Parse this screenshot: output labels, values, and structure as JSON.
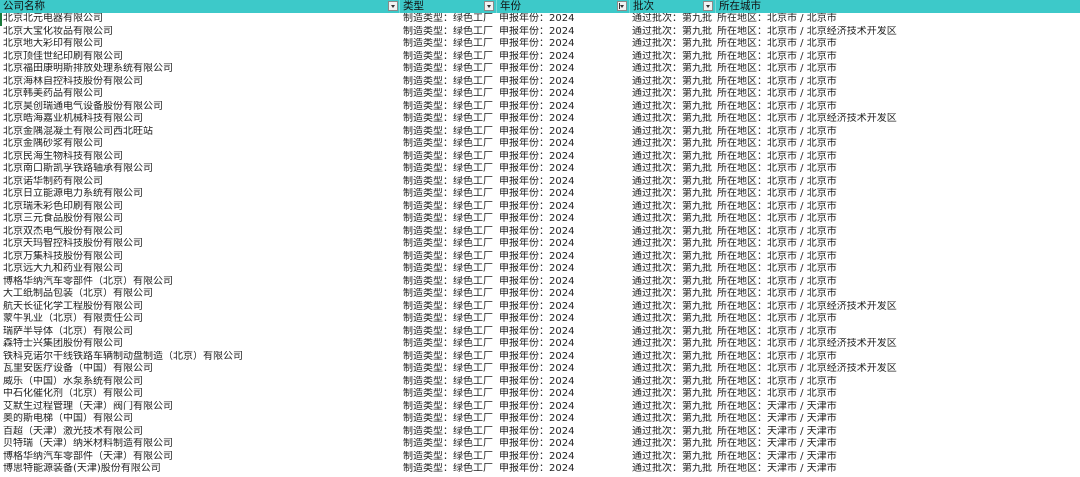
{
  "headers": {
    "company": "公司名称",
    "type": "类型",
    "year": "年份",
    "batch": "批次",
    "city": "所在城市"
  },
  "rows": [
    {
      "name": "北京北元电器有限公司",
      "type": "制造类型：绿色工厂",
      "year": "申报年份：2024",
      "batch": "通过批次：第九批",
      "city": "所在地区：北京市 / 北京市"
    },
    {
      "name": "北京大宝化妆品有限公司",
      "type": "制造类型：绿色工厂",
      "year": "申报年份：2024",
      "batch": "通过批次：第九批",
      "city": "所在地区：北京市 / 北京经济技术开发区"
    },
    {
      "name": "北京地大彩印有限公司",
      "type": "制造类型：绿色工厂",
      "year": "申报年份：2024",
      "batch": "通过批次：第九批",
      "city": "所在地区：北京市 / 北京市"
    },
    {
      "name": "北京顶佳世纪印刷有限公司",
      "type": "制造类型：绿色工厂",
      "year": "申报年份：2024",
      "batch": "通过批次：第九批",
      "city": "所在地区：北京市 / 北京市"
    },
    {
      "name": "北京福田康明斯排放处理系统有限公司",
      "type": "制造类型：绿色工厂",
      "year": "申报年份：2024",
      "batch": "通过批次：第九批",
      "city": "所在地区：北京市 / 北京市"
    },
    {
      "name": "北京海林自控科技股份有限公司",
      "type": "制造类型：绿色工厂",
      "year": "申报年份：2024",
      "batch": "通过批次：第九批",
      "city": "所在地区：北京市 / 北京市"
    },
    {
      "name": "北京韩美药品有限公司",
      "type": "制造类型：绿色工厂",
      "year": "申报年份：2024",
      "batch": "通过批次：第九批",
      "city": "所在地区：北京市 / 北京市"
    },
    {
      "name": "北京昊创瑞通电气设备股份有限公司",
      "type": "制造类型：绿色工厂",
      "year": "申报年份：2024",
      "batch": "通过批次：第九批",
      "city": "所在地区：北京市 / 北京市"
    },
    {
      "name": "北京皓海嘉业机械科技有限公司",
      "type": "制造类型：绿色工厂",
      "year": "申报年份：2024",
      "batch": "通过批次：第九批",
      "city": "所在地区：北京市 / 北京经济技术开发区"
    },
    {
      "name": "北京金隅混凝土有限公司西北旺站",
      "type": "制造类型：绿色工厂",
      "year": "申报年份：2024",
      "batch": "通过批次：第九批",
      "city": "所在地区：北京市 / 北京市"
    },
    {
      "name": "北京金隅砂浆有限公司",
      "type": "制造类型：绿色工厂",
      "year": "申报年份：2024",
      "batch": "通过批次：第九批",
      "city": "所在地区：北京市 / 北京市"
    },
    {
      "name": "北京民海生物科技有限公司",
      "type": "制造类型：绿色工厂",
      "year": "申报年份：2024",
      "batch": "通过批次：第九批",
      "city": "所在地区：北京市 / 北京市"
    },
    {
      "name": "北京南口斯凯孚铁路轴承有限公司",
      "type": "制造类型：绿色工厂",
      "year": "申报年份：2024",
      "batch": "通过批次：第九批",
      "city": "所在地区：北京市 / 北京市"
    },
    {
      "name": "北京诺华制药有限公司",
      "type": "制造类型：绿色工厂",
      "year": "申报年份：2024",
      "batch": "通过批次：第九批",
      "city": "所在地区：北京市 / 北京市"
    },
    {
      "name": "北京日立能源电力系统有限公司",
      "type": "制造类型：绿色工厂",
      "year": "申报年份：2024",
      "batch": "通过批次：第九批",
      "city": "所在地区：北京市 / 北京市"
    },
    {
      "name": "北京瑞禾彩色印刷有限公司",
      "type": "制造类型：绿色工厂",
      "year": "申报年份：2024",
      "batch": "通过批次：第九批",
      "city": "所在地区：北京市 / 北京市"
    },
    {
      "name": "北京三元食品股份有限公司",
      "type": "制造类型：绿色工厂",
      "year": "申报年份：2024",
      "batch": "通过批次：第九批",
      "city": "所在地区：北京市 / 北京市"
    },
    {
      "name": "北京双杰电气股份有限公司",
      "type": "制造类型：绿色工厂",
      "year": "申报年份：2024",
      "batch": "通过批次：第九批",
      "city": "所在地区：北京市 / 北京市"
    },
    {
      "name": "北京天玛智控科技股份有限公司",
      "type": "制造类型：绿色工厂",
      "year": "申报年份：2024",
      "batch": "通过批次：第九批",
      "city": "所在地区：北京市 / 北京市"
    },
    {
      "name": "北京万集科技股份有限公司",
      "type": "制造类型：绿色工厂",
      "year": "申报年份：2024",
      "batch": "通过批次：第九批",
      "city": "所在地区：北京市 / 北京市"
    },
    {
      "name": "北京远大九和药业有限公司",
      "type": "制造类型：绿色工厂",
      "year": "申报年份：2024",
      "batch": "通过批次：第九批",
      "city": "所在地区：北京市 / 北京市"
    },
    {
      "name": "博格华纳汽车零部件（北京）有限公司",
      "type": "制造类型：绿色工厂",
      "year": "申报年份：2024",
      "batch": "通过批次：第九批",
      "city": "所在地区：北京市 / 北京市"
    },
    {
      "name": "大工纸制品包装（北京）有限公司",
      "type": "制造类型：绿色工厂",
      "year": "申报年份：2024",
      "batch": "通过批次：第九批",
      "city": "所在地区：北京市 / 北京市"
    },
    {
      "name": "航天长征化学工程股份有限公司",
      "type": "制造类型：绿色工厂",
      "year": "申报年份：2024",
      "batch": "通过批次：第九批",
      "city": "所在地区：北京市 / 北京经济技术开发区"
    },
    {
      "name": "蒙牛乳业（北京）有限责任公司",
      "type": "制造类型：绿色工厂",
      "year": "申报年份：2024",
      "batch": "通过批次：第九批",
      "city": "所在地区：北京市 / 北京市"
    },
    {
      "name": "瑞萨半导体（北京）有限公司",
      "type": "制造类型：绿色工厂",
      "year": "申报年份：2024",
      "batch": "通过批次：第九批",
      "city": "所在地区：北京市 / 北京市"
    },
    {
      "name": "森特士兴集团股份有限公司",
      "type": "制造类型：绿色工厂",
      "year": "申报年份：2024",
      "batch": "通过批次：第九批",
      "city": "所在地区：北京市 / 北京经济技术开发区"
    },
    {
      "name": "铁科克诺尔干线铁路车辆制动盘制造（北京）有限公司",
      "type": "制造类型：绿色工厂",
      "year": "申报年份：2024",
      "batch": "通过批次：第九批",
      "city": "所在地区：北京市 / 北京市"
    },
    {
      "name": "瓦里安医疗设备（中国）有限公司",
      "type": "制造类型：绿色工厂",
      "year": "申报年份：2024",
      "batch": "通过批次：第九批",
      "city": "所在地区：北京市 / 北京经济技术开发区"
    },
    {
      "name": "威乐（中国）水泵系统有限公司",
      "type": "制造类型：绿色工厂",
      "year": "申报年份：2024",
      "batch": "通过批次：第九批",
      "city": "所在地区：北京市 / 北京市"
    },
    {
      "name": "中石化催化剂（北京）有限公司",
      "type": "制造类型：绿色工厂",
      "year": "申报年份：2024",
      "batch": "通过批次：第九批",
      "city": "所在地区：北京市 / 北京市"
    },
    {
      "name": "艾默生过程管理（天津）阀门有限公司",
      "type": "制造类型：绿色工厂",
      "year": "申报年份：2024",
      "batch": "通过批次：第九批",
      "city": "所在地区：天津市 / 天津市"
    },
    {
      "name": "奥的斯电梯（中国）有限公司",
      "type": "制造类型：绿色工厂",
      "year": "申报年份：2024",
      "batch": "通过批次：第九批",
      "city": "所在地区：天津市 / 天津市"
    },
    {
      "name": "百超（天津）激光技术有限公司",
      "type": "制造类型：绿色工厂",
      "year": "申报年份：2024",
      "batch": "通过批次：第九批",
      "city": "所在地区：天津市 / 天津市"
    },
    {
      "name": "贝特瑞（天津）纳米材料制造有限公司",
      "type": "制造类型：绿色工厂",
      "year": "申报年份：2024",
      "batch": "通过批次：第九批",
      "city": "所在地区：天津市 / 天津市"
    },
    {
      "name": "博格华纳汽车零部件（天津）有限公司",
      "type": "制造类型：绿色工厂",
      "year": "申报年份：2024",
      "batch": "通过批次：第九批",
      "city": "所在地区：天津市 / 天津市"
    },
    {
      "name": "博思特能源装备(天津)股份有限公司",
      "type": "制造类型：绿色工厂",
      "year": "申报年份：2024",
      "batch": "通过批次：第九批",
      "city": "所在地区：天津市 / 天津市"
    }
  ],
  "colors": {
    "header_bg": "#3dc9c9",
    "text": "#222222"
  },
  "icons": {
    "filter": "filter-dropdown-icon",
    "sorted_filter": "sort-filter-icon"
  }
}
